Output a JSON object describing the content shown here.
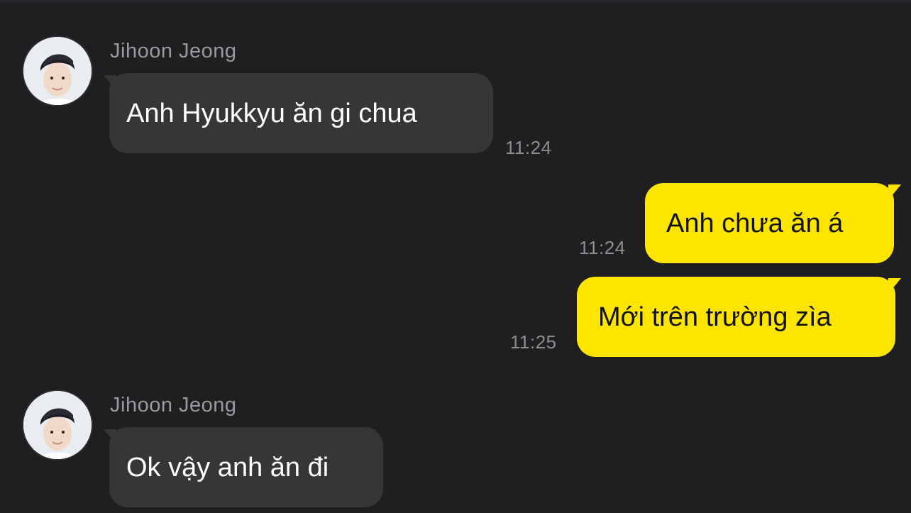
{
  "conversation": {
    "messages": [
      {
        "sender": "Jihoon Jeong",
        "text": "Anh Hyukkyu ăn gi chua",
        "time": "11:24",
        "direction": "incoming"
      },
      {
        "text": "Anh chưa ăn á",
        "time": "11:24",
        "direction": "outgoing"
      },
      {
        "text": "Mới trên trường zìa",
        "time": "11:25",
        "direction": "outgoing"
      },
      {
        "sender": "Jihoon Jeong",
        "text": "Ok vậy anh ăn đi",
        "direction": "incoming"
      }
    ]
  },
  "colors": {
    "background": "#1f1f21",
    "incoming_bubble": "#363638",
    "outgoing_bubble": "#fee500",
    "timestamp": "#8e8e92",
    "sender_name": "#9a9a9e"
  }
}
